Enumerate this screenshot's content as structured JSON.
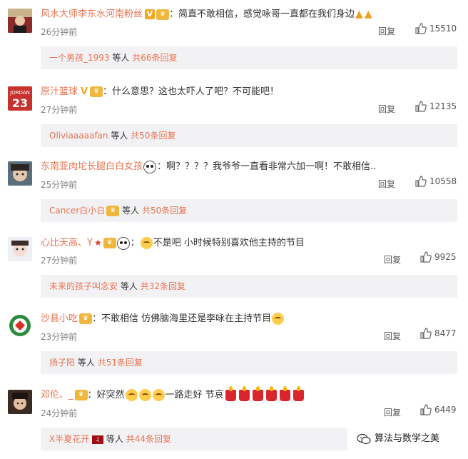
{
  "comments": [
    {
      "username": "风水大师李东水河南粉丝",
      "badges": [
        "vip-badge-icon",
        "level-badge-icon"
      ],
      "text": "简直不敢相信，感觉咏哥一直都在我们身边",
      "trailing_emojis": [
        "pray-icon",
        "pray-icon"
      ],
      "time": "26分钟前",
      "reply_label": "回复",
      "likes": "15510",
      "sub_user": "一个男孩_1993",
      "sub_mid": "等人",
      "sub_total": "共66条回复"
    },
    {
      "username": "原汁篮球",
      "badges": [
        "gold-v-icon",
        "level-badge-icon"
      ],
      "text": "什么意思？这也太吓人了吧？不可能吧！",
      "time": "27分钟前",
      "reply_label": "回复",
      "likes": "12135",
      "sub_user": "Oliviaaaaafan",
      "sub_mid": "等人",
      "sub_total": "共50条回复"
    },
    {
      "username": "东南亚肉坨长腿白白女孩",
      "badges": [
        "panda-icon"
      ],
      "text": "啊？？？？我爷爷一直看非常六加一啊！不敢相信..",
      "time": "25分钟前",
      "reply_label": "回复",
      "likes": "10558",
      "sub_user": "Cancer白小白",
      "sub_mid": "等人",
      "sub_total": "共50条回复"
    },
    {
      "username": "心比天高、Y",
      "badges": [
        "star-icon",
        "level-badge-icon",
        "panda-icon"
      ],
      "text": "不是吧 小时候特别喜欢他主持的节目",
      "time": "27分钟前",
      "reply_label": "回复",
      "likes": "9925",
      "sub_user": "未来的孩子叫念安",
      "sub_mid": "等人",
      "sub_total": "共32条回复"
    },
    {
      "username": "沙县小吃",
      "badges": [
        "level-badge-icon"
      ],
      "text": "不敢相信 仿佛脑海里还是李咏在主持节目",
      "time": "23分钟前",
      "reply_label": "回复",
      "likes": "8477",
      "sub_user": "扬子阳",
      "sub_mid": "等人",
      "sub_total": "共51条回复"
    },
    {
      "username": "邓伦、_",
      "badges": [
        "level-badge-icon"
      ],
      "text_a": "好突然",
      "text_b": "一路走好 节哀",
      "time": "24分钟前",
      "reply_label": "回复",
      "likes": "6449",
      "sub_user": "X半夏花开",
      "sub_mid": "等人",
      "sub_total": "共44条回复"
    }
  ],
  "watermark": {
    "text": "算法与数学之美"
  },
  "colors": {
    "username": "#eb7350",
    "subbox_bg": "#f2f2f5",
    "time": "#808080"
  }
}
